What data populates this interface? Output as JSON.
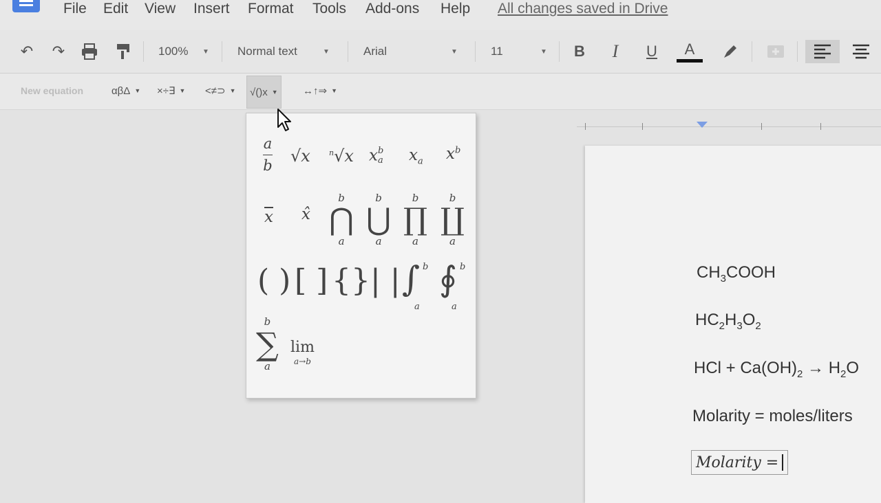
{
  "menu": {
    "items": [
      "File",
      "Edit",
      "View",
      "Insert",
      "Format",
      "Tools",
      "Add-ons",
      "Help"
    ],
    "save_status": "All changes saved in Drive"
  },
  "toolbar": {
    "zoom": "100%",
    "style": "Normal text",
    "font": "Arial",
    "font_size": "11",
    "bold": "B",
    "italic": "I",
    "underline": "U",
    "text_color": "A",
    "text_color_hex": "#111111"
  },
  "equation_toolbar": {
    "new_equation": "New equation",
    "greek": "αβΔ",
    "operations": "×÷∃",
    "relations": "<≠⊃",
    "math_ops": "√()x",
    "arrows": "↔↑⇒"
  },
  "math_palette": {
    "row1": [
      "a/b",
      "√x",
      "ⁿ√x",
      "x_a^b",
      "x_a",
      "x^b"
    ],
    "row2": [
      "x̄",
      "x̂",
      "∩",
      "∪",
      "∏",
      "∐"
    ],
    "row3": [
      "( )",
      "[ ]",
      "{ }",
      "| |",
      "∫",
      "∮"
    ],
    "row4": [
      "∑",
      "lim"
    ],
    "lower_limit": "a",
    "upper_limit": "b",
    "var": "x",
    "lim_label": "lim",
    "lim_sub": "a→b"
  },
  "document": {
    "lines": [
      "CH3COOH",
      "HC2H3O2",
      "HCl + Ca(OH)2 → H2O",
      "Molarity = moles/liters"
    ],
    "equation_text": "Molarity ="
  }
}
